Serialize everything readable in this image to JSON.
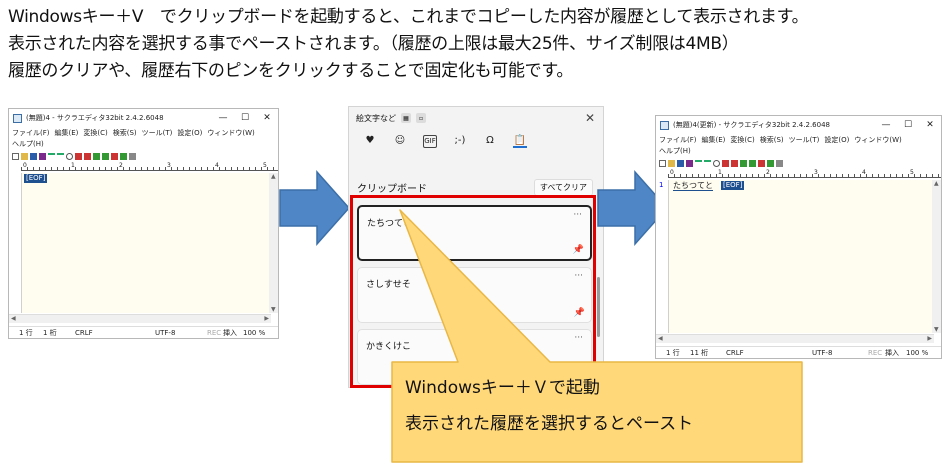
{
  "intro": {
    "line1": "Windowsキー＋V　でクリップボードを起動すると、これまでコピーした内容が履歴として表示されます。",
    "line2": "表示された内容を選択する事でペーストされます。（履歴の上限は最大25件、サイズ制限は4MB）",
    "line3": "履歴のクリアや、履歴右下のピンをクリックすることで固定化も可能です。"
  },
  "editor_before": {
    "title": "(無題)4 - サクラエディタ32bit 2.4.2.6048",
    "menu": [
      "ファイル(F)",
      "編集(E)",
      "変換(C)",
      "検索(S)",
      "ツール(T)",
      "設定(O)",
      "ウィンドウ(W)",
      "ヘルプ(H)"
    ],
    "ruler_marks": [
      "0",
      "1",
      "2",
      "3",
      "4",
      "5"
    ],
    "eof": "[EOF]",
    "status": {
      "line": "1 行",
      "col": "1 桁",
      "eol": "CRLF",
      "enc": "UTF-8",
      "rec": "REC",
      "mode": "挿入",
      "zoom": "100 %"
    }
  },
  "editor_after": {
    "title": "(無題)4(更新) - サクラエディタ32bit 2.4.2.6048",
    "menu": [
      "ファイル(F)",
      "編集(E)",
      "変換(C)",
      "検索(S)",
      "ツール(T)",
      "設定(O)",
      "ウィンドウ(W)",
      "ヘルプ(H)"
    ],
    "ruler_marks": [
      "0",
      "1",
      "2",
      "3",
      "4",
      "5"
    ],
    "line_number": "1",
    "pasted_text": "たちつてと",
    "eof": "[EOF]",
    "status": {
      "line": "1 行",
      "col": "11 桁",
      "eol": "CRLF",
      "enc": "UTF-8",
      "rec": "REC",
      "mode": "挿入",
      "zoom": "100 %"
    }
  },
  "clipboard": {
    "tab_title": "絵文字など",
    "icons": [
      "heart-icon",
      "smiley-icon",
      "gif-icon",
      "kaomoji-icon",
      "symbols-icon",
      "clipboard-icon"
    ],
    "icon_glyphs": [
      "♥",
      "☺",
      "GIF",
      ";-)",
      "Ω",
      "📋"
    ],
    "header": "クリップボード",
    "clear_all": "すべてクリア",
    "items": [
      "たちつてと",
      "さしすせそ",
      "かきくけこ"
    ]
  },
  "callout": {
    "line1": "Windowsキー＋Ｖで起動",
    "line2": "表示された履歴を選択するとペースト",
    "fill": "#ffd87a",
    "border": "#e9b745"
  },
  "colors": {
    "arrow": "#4f87c6",
    "arrow_border": "#3b6fa8",
    "highlight": "#e00000",
    "eof_bg": "#1e4f8e"
  }
}
